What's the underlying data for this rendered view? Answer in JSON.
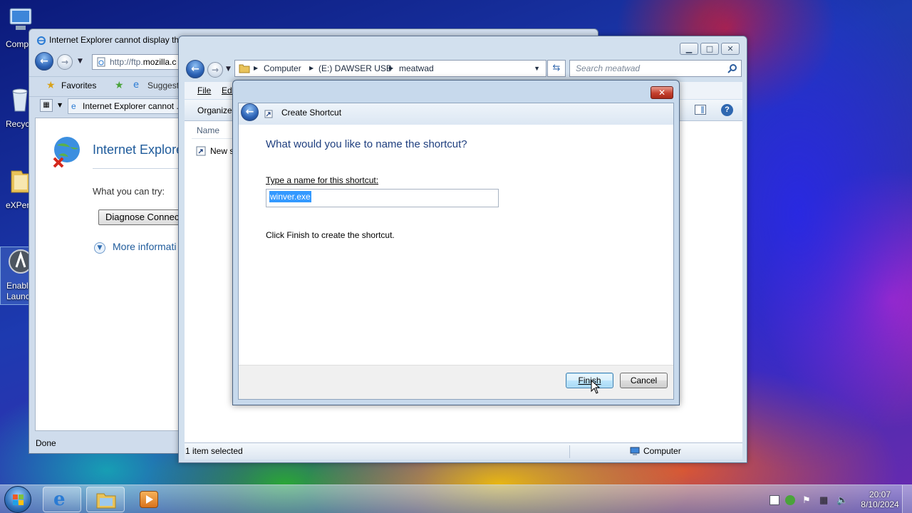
{
  "desktop": {
    "icons": [
      {
        "label": "Comp",
        "icon": "computer-icon"
      },
      {
        "label": "Recyc",
        "icon": "recycle-bin-icon"
      },
      {
        "label": "eXPer",
        "icon": "folder-icon"
      },
      {
        "label": "Enable",
        "label2": "Launc",
        "icon": "launcher-icon"
      }
    ]
  },
  "ie": {
    "title": "Internet Explorer cannot display th",
    "address_prefix": "http://ftp.",
    "address_host": "mozilla.c",
    "favorites_label": "Favorites",
    "suggested_label": "Suggeste",
    "tab_label": "Internet Explorer cannot ...",
    "heading": "Internet Explore",
    "what_you_can_try": "What you can try:",
    "diagnose_button": "Diagnose Connect",
    "more_info": "More informati",
    "status": "Done"
  },
  "explorer": {
    "breadcrumb": [
      "Computer",
      "(E:) DAWSER USB",
      "meatwad"
    ],
    "search_placeholder": "Search meatwad",
    "menu": {
      "file": "File",
      "edit": "Edi"
    },
    "organize": "Organize",
    "column_name": "Name",
    "file_item": "New s",
    "status_left": "1 item selected",
    "status_right": "Computer"
  },
  "dialog": {
    "title": "Create Shortcut",
    "question": "What would you like to name the shortcut?",
    "name_label": "Type a name for this shortcut:",
    "name_value": "winver.exe",
    "hint": "Click Finish to create the shortcut.",
    "finish_label": "Finish",
    "cancel_label": "Cancel",
    "close_glyph": "✕"
  },
  "taskbar": {
    "time": "20:07",
    "date": "8/10/2024",
    "buttons": [
      "start-orb-icon",
      "internet-explorer-icon",
      "windows-explorer-icon",
      "media-player-icon"
    ]
  }
}
